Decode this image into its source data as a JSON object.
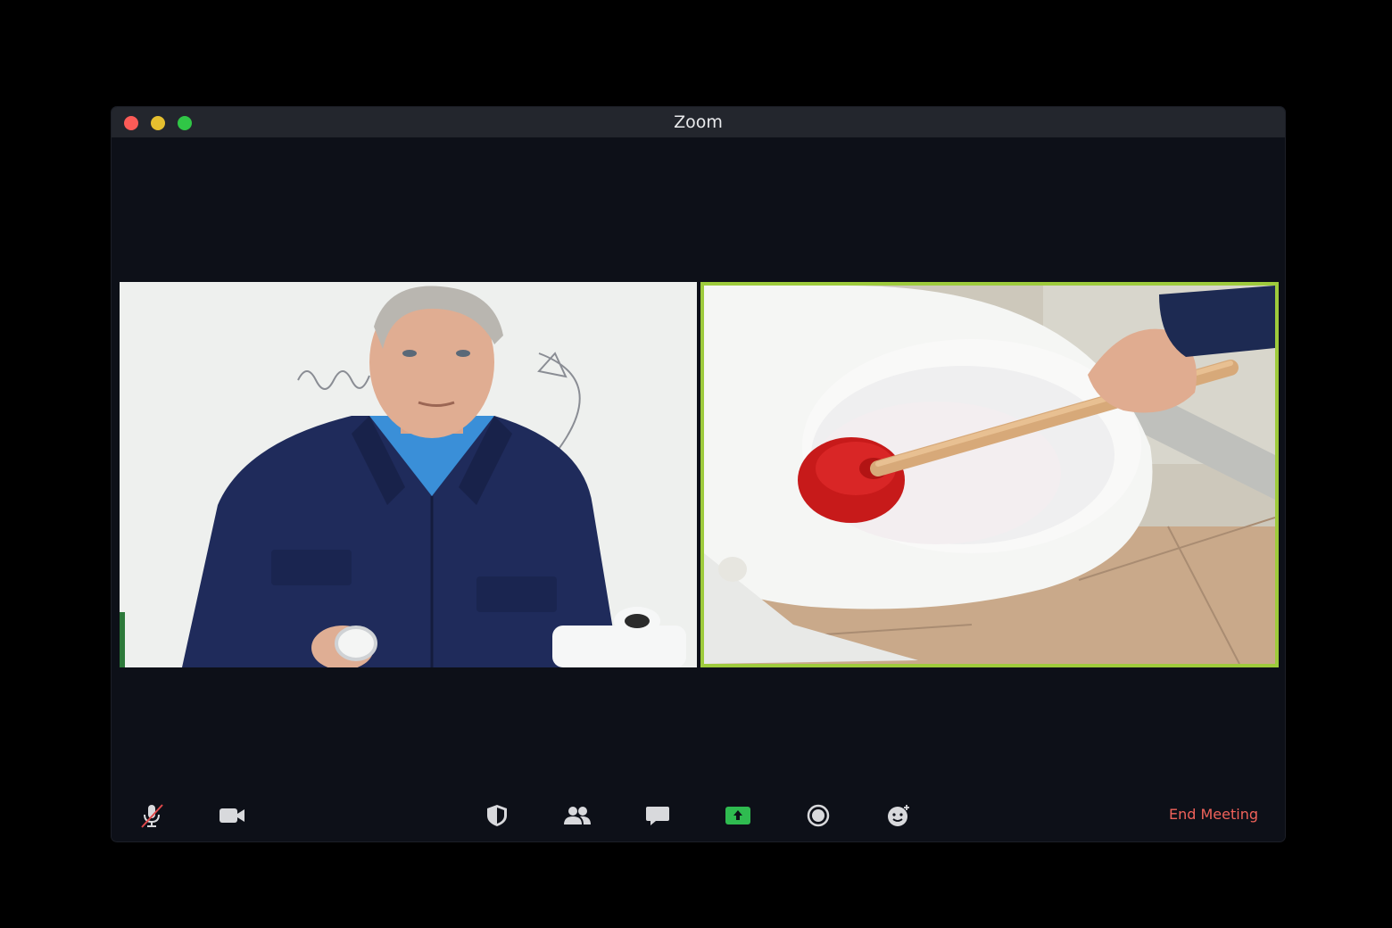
{
  "window": {
    "title": "Zoom"
  },
  "controls": {
    "close_color": "#fc5b57",
    "minimize_color": "#e5bf2f",
    "maximize_color": "#30c646"
  },
  "participants": [
    {
      "tile": "left",
      "description_icon": "video-feed",
      "active_speaker": false
    },
    {
      "tile": "right",
      "description_icon": "video-feed",
      "active_speaker": true
    }
  ],
  "toolbar": {
    "mute_icon": "microphone-muted-icon",
    "video_icon": "video-camera-icon",
    "security_icon": "shield-icon",
    "participants_icon": "people-icon",
    "chat_icon": "chat-bubble-icon",
    "share_icon": "share-screen-icon",
    "record_icon": "record-icon",
    "reactions_icon": "emoji-icon",
    "end_label": "End Meeting",
    "end_color": "#f0625a",
    "share_color": "#2fbb50",
    "active_speaker_color": "#9ecb3c"
  }
}
